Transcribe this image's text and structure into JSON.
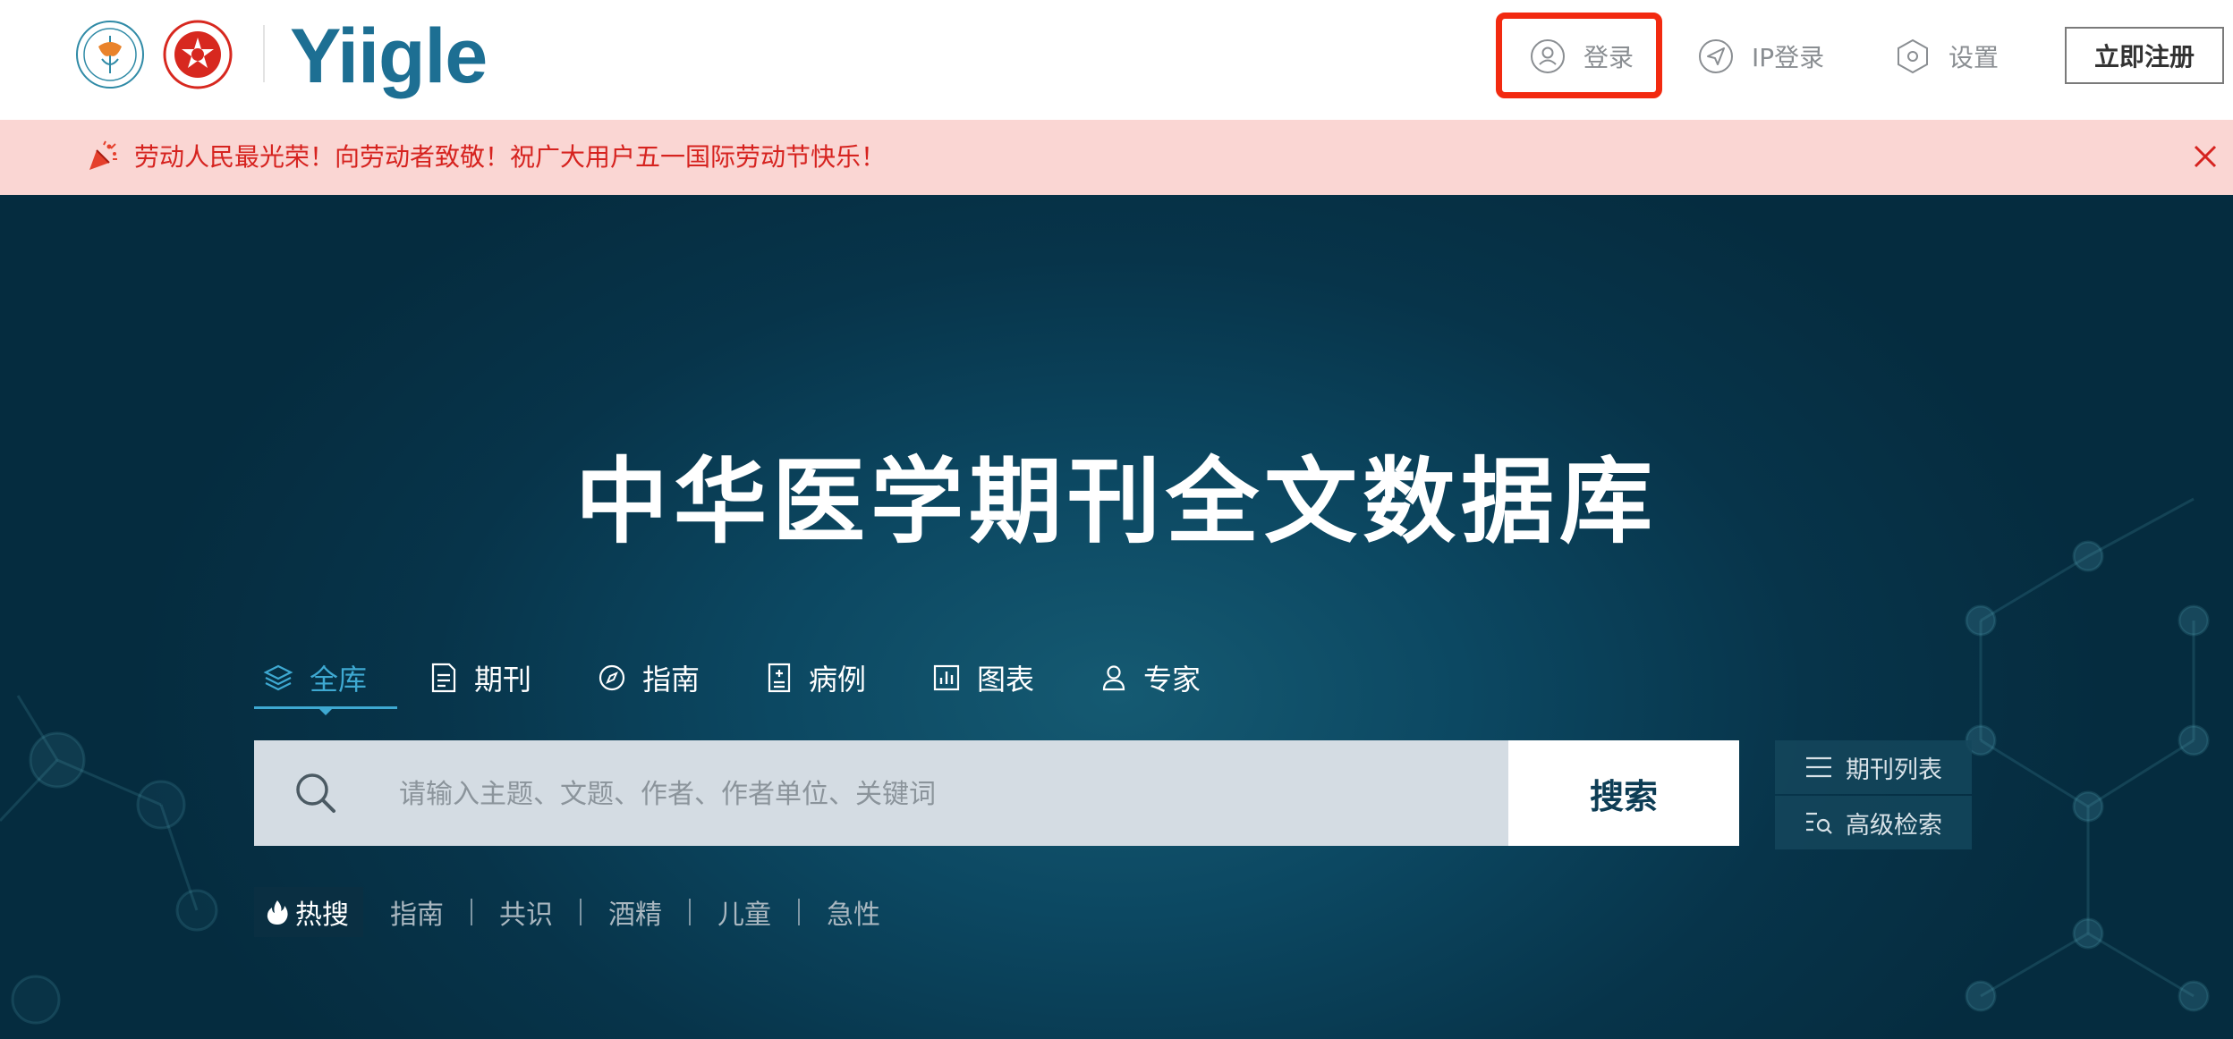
{
  "header": {
    "logo1_alt": "chinese-medical-association-logo",
    "logo2_alt": "cmaph-logo",
    "brand": "Yiigle",
    "nav": {
      "login": "登录",
      "ip_login": "IP登录",
      "settings": "设置",
      "register": "立即注册"
    }
  },
  "announcement": {
    "text": "劳动人民最光荣！向劳动者致敬！祝广大用户五一国际劳动节快乐！"
  },
  "hero": {
    "title": "中华医学期刊全文数据库"
  },
  "tabs": [
    {
      "label": "全库",
      "icon": "layers-icon",
      "active": true
    },
    {
      "label": "期刊",
      "icon": "journal-icon",
      "active": false
    },
    {
      "label": "指南",
      "icon": "compass-icon",
      "active": false
    },
    {
      "label": "病例",
      "icon": "case-icon",
      "active": false
    },
    {
      "label": "图表",
      "icon": "chart-icon",
      "active": false
    },
    {
      "label": "专家",
      "icon": "expert-icon",
      "active": false
    }
  ],
  "search": {
    "placeholder": "请输入主题、文题、作者、作者单位、关键词",
    "value": "",
    "button": "搜索"
  },
  "side": {
    "journals": "期刊列表",
    "advanced": "高级检索"
  },
  "hot": {
    "label": "热搜",
    "items": [
      "指南",
      "共识",
      "酒精",
      "儿童",
      "急性"
    ]
  },
  "colors": {
    "brand": "#1d6f93",
    "active_tab": "#3ea9d2",
    "highlight_border": "#f22a10",
    "announcement_bg": "#fad6d3",
    "announcement_text": "#d6231f",
    "hero_bg": "#0c4862"
  }
}
